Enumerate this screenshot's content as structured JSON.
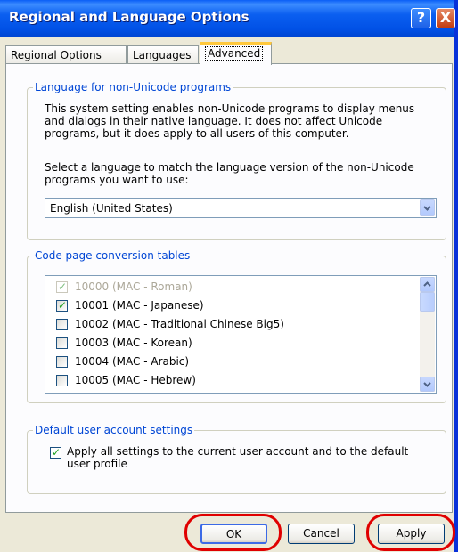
{
  "window": {
    "title": "Regional and Language Options",
    "help_glyph": "?",
    "close_glyph": "X"
  },
  "tabs": [
    {
      "label": "Regional Options"
    },
    {
      "label": "Languages"
    },
    {
      "label": "Advanced",
      "active": true
    }
  ],
  "non_unicode": {
    "legend": "Language for non-Unicode programs",
    "desc_lines": [
      "This system setting enables non-Unicode programs to display menus",
      "and dialogs in their native language. It does not affect Unicode",
      "programs, but it does apply to all users of this computer."
    ],
    "select_lines": [
      "Select a language to match the language version of the non-Unicode",
      "programs you want to use:"
    ],
    "selected_language": "English (United States)"
  },
  "code_pages": {
    "legend": "Code page conversion tables",
    "items": [
      {
        "label": "10000 (MAC - Roman)",
        "checked": true,
        "disabled": true
      },
      {
        "label": "10001 (MAC - Japanese)",
        "checked": true,
        "disabled": false
      },
      {
        "label": "10002 (MAC - Traditional Chinese Big5)",
        "checked": false,
        "disabled": false
      },
      {
        "label": "10003 (MAC - Korean)",
        "checked": false,
        "disabled": false
      },
      {
        "label": "10004 (MAC - Arabic)",
        "checked": false,
        "disabled": false
      },
      {
        "label": "10005 (MAC - Hebrew)",
        "checked": false,
        "disabled": false
      }
    ]
  },
  "default_user": {
    "legend": "Default user account settings",
    "checkbox_line1": "Apply all settings to the current user account and to the default",
    "checkbox_line2": "user profile",
    "checked": true
  },
  "buttons": {
    "ok": "OK",
    "cancel": "Cancel",
    "apply": "Apply"
  },
  "icons": {
    "check": "✓",
    "up": "▲",
    "down": "▼"
  },
  "colors": {
    "annotation_circle": "#e00000",
    "group_legend": "#0046d5"
  }
}
